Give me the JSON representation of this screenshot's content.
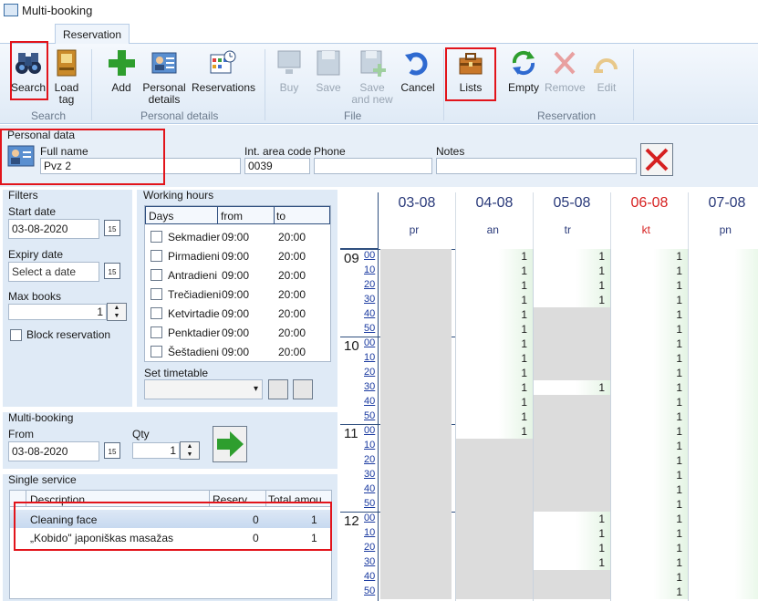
{
  "window": {
    "title": "Multi-booking"
  },
  "tabs": [
    {
      "label": "Reservation"
    }
  ],
  "ribbon": {
    "buttons": {
      "search": "Search",
      "load_tag_1": "Load",
      "load_tag_2": "tag",
      "add": "Add",
      "personal_details_1": "Personal",
      "personal_details_2": "details",
      "reservations": "Reservations",
      "buy": "Buy",
      "save": "Save",
      "save_new_1": "Save",
      "save_new_2": "and new",
      "cancel": "Cancel",
      "lists": "Lists",
      "empty": "Empty",
      "remove": "Remove",
      "edit": "Edit"
    },
    "groups": {
      "search": "Search",
      "personal_details": "Personal details",
      "file": "File",
      "reservation": "Reservation"
    }
  },
  "personal_data": {
    "title": "Personal data",
    "full_name_label": "Full name",
    "full_name": "Pvz 2",
    "area_code_label": "Int. area code",
    "area_code": "0039",
    "phone_label": "Phone",
    "phone": "",
    "notes_label": "Notes",
    "notes": ""
  },
  "filters": {
    "title": "Filters",
    "start_date_label": "Start date",
    "start_date": "03-08-2020",
    "expiry_date_label": "Expiry date",
    "expiry_date_placeholder": "Select a date",
    "max_books_label": "Max books",
    "max_books": "1",
    "block_reservation_label": "Block reservation",
    "calendar_icon_text": "15"
  },
  "working_hours": {
    "title": "Working hours",
    "headers": [
      "Days",
      "from",
      "to"
    ],
    "rows": [
      {
        "day": "Sekmadier",
        "from": "09:00",
        "to": "20:00"
      },
      {
        "day": "Pirmadieni",
        "from": "09:00",
        "to": "20:00"
      },
      {
        "day": "Antradieni",
        "from": "09:00",
        "to": "20:00"
      },
      {
        "day": "Trečiadieni",
        "from": "09:00",
        "to": "20:00"
      },
      {
        "day": "Ketvirtadie",
        "from": "09:00",
        "to": "20:00"
      },
      {
        "day": "Penktadier",
        "from": "09:00",
        "to": "20:00"
      },
      {
        "day": "Šeštadieni",
        "from": "09:00",
        "to": "20:00"
      }
    ],
    "set_timetable_label": "Set timetable"
  },
  "multi_booking": {
    "title": "Multi-booking",
    "from_label": "From",
    "from": "03-08-2020",
    "qty_label": "Qty",
    "qty": "1"
  },
  "single_service": {
    "title": "Single service",
    "headers": [
      "Description",
      "Reserv",
      "Total amou"
    ],
    "rows": [
      {
        "description": "Cleaning face",
        "reserv": "0",
        "total": "1"
      },
      {
        "description": "„Kobido\" japoniškas masažas",
        "reserv": "0",
        "total": "1"
      }
    ]
  },
  "schedule": {
    "days": [
      {
        "date": "03-08",
        "weekday": "pr",
        "color": "#2a3a7a"
      },
      {
        "date": "04-08",
        "weekday": "an",
        "color": "#2a3a7a"
      },
      {
        "date": "05-08",
        "weekday": "tr",
        "color": "#2a3a7a"
      },
      {
        "date": "06-08",
        "weekday": "kt",
        "color": "#d62020"
      },
      {
        "date": "07-08",
        "weekday": "pn",
        "color": "#2a3a7a"
      }
    ],
    "hours": [
      "09",
      "10",
      "11",
      "12"
    ],
    "minutes": [
      "00",
      "10",
      "20",
      "30",
      "40",
      "50"
    ],
    "slot_value": "1",
    "availability": {
      "04-08": [
        "1",
        "1",
        "1",
        "1",
        "1",
        "1",
        "1",
        "1",
        "1",
        "1",
        "1",
        "1",
        "1",
        "",
        "",
        "",
        "",
        "",
        "",
        "",
        "",
        "",
        "",
        ""
      ],
      "05-08": [
        "1",
        "1",
        "1",
        "1",
        "",
        "",
        "",
        "",
        "",
        "1",
        "",
        "",
        "",
        "",
        "",
        "",
        "",
        "",
        "1",
        "1",
        "1",
        "1",
        "",
        ""
      ],
      "06-08": [
        "1",
        "1",
        "1",
        "1",
        "1",
        "1",
        "1",
        "1",
        "1",
        "1",
        "1",
        "1",
        "1",
        "1",
        "1",
        "1",
        "1",
        "1",
        "1",
        "1",
        "1",
        "1",
        "1",
        "1"
      ]
    }
  }
}
